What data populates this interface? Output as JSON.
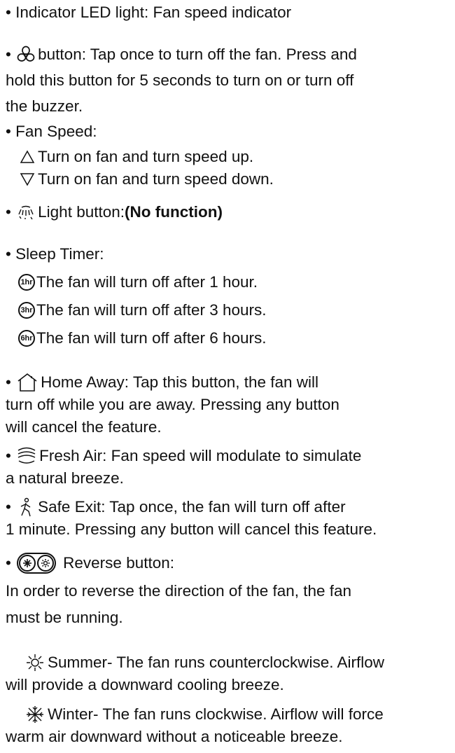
{
  "bullet": "•",
  "indicator": {
    "text": "Indicator LED light: Fan speed indicator"
  },
  "power": {
    "icon": "fan-power-icon",
    "line1": "button: Tap once to turn off the fan. Press and",
    "line2": "hold this button for 5 seconds to turn on or turn off",
    "line3": "the buzzer."
  },
  "fan_speed": {
    "title": "Fan Speed:",
    "up": {
      "icon": "triangle-up-icon",
      "text": "Turn on fan and turn speed up."
    },
    "down": {
      "icon": "triangle-down-icon",
      "text": "Turn on fan and turn speed down."
    }
  },
  "light": {
    "icon": "light-icon",
    "text": "Light button: ",
    "bold": "(No function)"
  },
  "sleep": {
    "title": "Sleep Timer:",
    "items": [
      {
        "badge": "1hr",
        "text": "The fan will turn off after 1 hour."
      },
      {
        "badge": "3hr",
        "text": "The fan will turn off after 3 hours."
      },
      {
        "badge": "6hr",
        "text": "The fan will turn off after 6 hours."
      }
    ]
  },
  "home_away": {
    "icon": "home-icon",
    "line1": "Home Away: Tap this button, the fan will",
    "line2": "turn off while you are away. Pressing any button",
    "line3": "will cancel the feature."
  },
  "fresh_air": {
    "icon": "fresh-air-icon",
    "line1": "Fresh Air: Fan speed will modulate to simulate",
    "line2": "a natural breeze."
  },
  "safe_exit": {
    "icon": "walking-person-icon",
    "line1": "Safe Exit: Tap once, the fan will turn off after",
    "line2": "1 minute. Pressing any button will cancel this feature."
  },
  "reverse": {
    "icon": "reverse-icon",
    "title": "Reverse button:",
    "line1": "In order to reverse the direction of the fan, the fan",
    "line2": "must be running."
  },
  "summer": {
    "icon": "sun-icon",
    "line1": "Summer- The fan runs counterclockwise. Airflow",
    "line2": "will provide a downward cooling breeze."
  },
  "winter": {
    "icon": "snowflake-icon",
    "line1": "Winter- The fan runs clockwise. Airflow will force",
    "line2": "warm air downward without a noticeable breeze."
  }
}
